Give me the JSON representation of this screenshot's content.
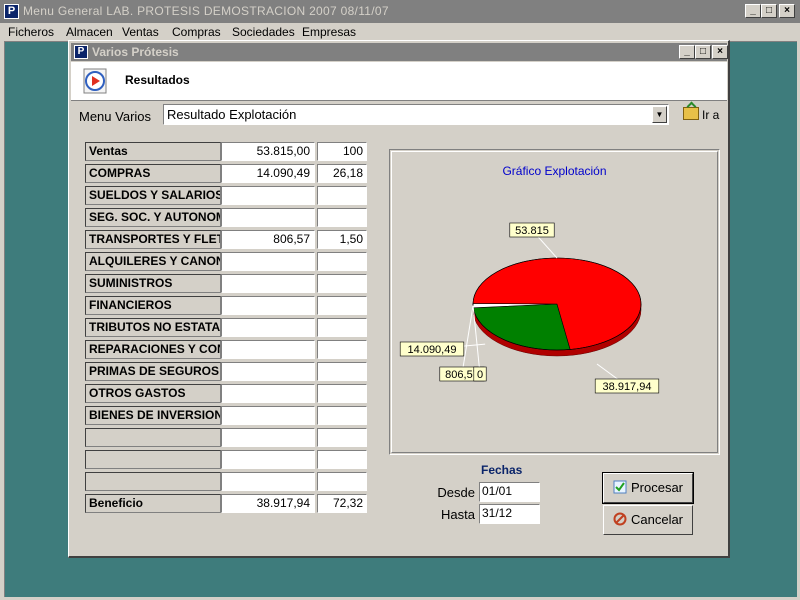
{
  "app": {
    "title": "Menu General  LAB. PROTESIS DEMOSTRACION  2007  08/11/07",
    "icon_letter": "P"
  },
  "menubar": [
    "Ficheros",
    "Almacen",
    "Ventas",
    "Compras",
    "Sociedades",
    "Empresas"
  ],
  "window": {
    "title": "Varios Prótesis",
    "icon_letter": "P",
    "header": "Resultados"
  },
  "menu_varios": {
    "label": "Menu Varios",
    "selected": "Resultado Explotación",
    "go_label": "Ir a"
  },
  "table": {
    "rows": [
      {
        "label": "Ventas",
        "amount": "53.815,00",
        "pct": "100"
      },
      {
        "label": "COMPRAS",
        "amount": "14.090,49",
        "pct": "26,18"
      },
      {
        "label": "SUELDOS Y SALARIOS",
        "amount": "",
        "pct": ""
      },
      {
        "label": "SEG. SOC. Y AUTONOMOS",
        "amount": "",
        "pct": ""
      },
      {
        "label": "TRANSPORTES Y FLETES",
        "amount": "806,57",
        "pct": "1,50"
      },
      {
        "label": "ALQUILERES Y CANONES",
        "amount": "",
        "pct": ""
      },
      {
        "label": "SUMINISTROS",
        "amount": "",
        "pct": ""
      },
      {
        "label": "FINANCIEROS",
        "amount": "",
        "pct": ""
      },
      {
        "label": "TRIBUTOS NO ESTATALES",
        "amount": "",
        "pct": ""
      },
      {
        "label": "REPARACIONES Y CONSERVACION",
        "amount": "",
        "pct": ""
      },
      {
        "label": "PRIMAS DE SEGUROS",
        "amount": "",
        "pct": ""
      },
      {
        "label": "OTROS GASTOS",
        "amount": "",
        "pct": ""
      },
      {
        "label": "BIENES DE INVERSION",
        "amount": "",
        "pct": ""
      },
      {
        "label": "",
        "amount": "",
        "pct": ""
      },
      {
        "label": "",
        "amount": "",
        "pct": ""
      },
      {
        "label": "",
        "amount": "",
        "pct": ""
      },
      {
        "label": "Beneficio",
        "amount": "38.917,94",
        "pct": "72,32"
      }
    ]
  },
  "chart_data": {
    "type": "pie",
    "title": "Gráfico Explotación",
    "slices": [
      {
        "label": "53.815",
        "value": 53815,
        "color": "#ff0000"
      },
      {
        "label": "14.090,49",
        "value": 14090.49,
        "color": "#008000"
      },
      {
        "label": "806,57",
        "value": 806.57,
        "color": "#ffffff"
      },
      {
        "label": "0",
        "value": 0,
        "color": "#000000"
      },
      {
        "label": "38.917,94",
        "value": 38917.94,
        "color": "#ff0000"
      }
    ]
  },
  "fechas": {
    "title": "Fechas",
    "desde_label": "Desde",
    "desde_value": "01/01",
    "hasta_label": "Hasta",
    "hasta_value": "31/12"
  },
  "buttons": {
    "procesar": "Procesar",
    "cancelar": "Cancelar"
  },
  "colors": {
    "desktop": "#3e7c7c",
    "face": "#d4d0c8",
    "inactive_title": "#808080",
    "chart_title": "#0000cc",
    "label_bg": "#ffffcc"
  }
}
